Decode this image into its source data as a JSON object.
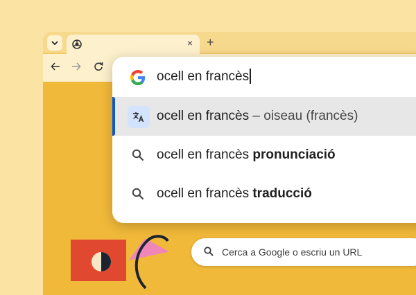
{
  "tabstrip": {
    "close_glyph": "×",
    "new_tab_glyph": "+"
  },
  "ntp": {
    "search_placeholder": "Cerca a Google o escriu un URL"
  },
  "omnibox": {
    "query": "ocell en francès",
    "suggestions": [
      {
        "text": "ocell en francès",
        "separator": " – ",
        "answer": "oiseau (francès)",
        "icon": "translate-icon"
      },
      {
        "text": "ocell en francès ",
        "bold": "pronunciació",
        "icon": "search-icon"
      },
      {
        "text": "ocell en francès ",
        "bold": "traducció",
        "icon": "search-icon"
      }
    ]
  },
  "colors": {
    "accent": "#0b57d0",
    "background": "#fbe3a3",
    "page": "#f1b93a"
  }
}
